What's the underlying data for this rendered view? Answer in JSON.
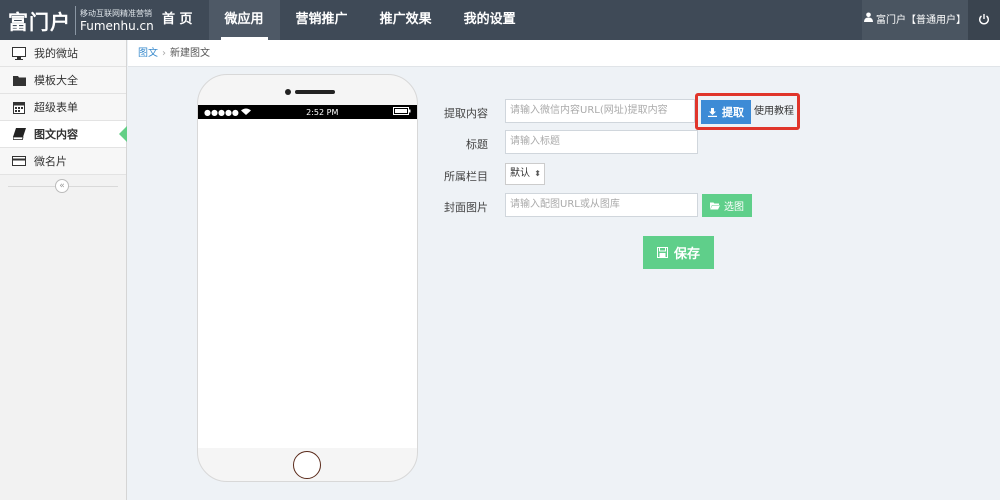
{
  "logo": {
    "main": "富门户",
    "tagline": "移动互联网精准营销",
    "domain": "Fumenhu.cn"
  },
  "nav": [
    {
      "label": "首 页"
    },
    {
      "label": "微应用",
      "active": true
    },
    {
      "label": "营销推广"
    },
    {
      "label": "推广效果"
    },
    {
      "label": "我的设置"
    }
  ],
  "user": {
    "label": "富门户【普通用户】",
    "icon": "user-icon"
  },
  "power_icon": "power-icon",
  "sidebar": {
    "items": [
      {
        "label": "我的微站",
        "icon": "monitor-icon"
      },
      {
        "label": "模板大全",
        "icon": "folder-icon"
      },
      {
        "label": "超级表单",
        "icon": "calendar-icon"
      },
      {
        "label": "图文内容",
        "icon": "book-icon",
        "active": true
      },
      {
        "label": "微名片",
        "icon": "card-icon"
      }
    ],
    "collapse": "«"
  },
  "breadcrumb": {
    "parent": "图文",
    "current": "新建图文"
  },
  "phone": {
    "signal": "●●●●● ",
    "time": "2:52 PM"
  },
  "form": {
    "fetch_label": "提取内容",
    "fetch_placeholder": "请输入微信内容URL(网址)提取内容",
    "fetch_button": "提取",
    "tutorial": "使用教程",
    "title_label": "标题",
    "title_placeholder": "请输入标题",
    "column_label": "所属栏目",
    "column_value": "默认",
    "cover_label": "封面图片",
    "cover_placeholder": "请输入配图URL或从图库",
    "pick_button": "选图",
    "save_button": "保存"
  },
  "colors": {
    "navbar": "#3f4a57",
    "accent_blue": "#3d8bd6",
    "accent_green": "#5fcf8a",
    "highlight": "#e0352b"
  }
}
